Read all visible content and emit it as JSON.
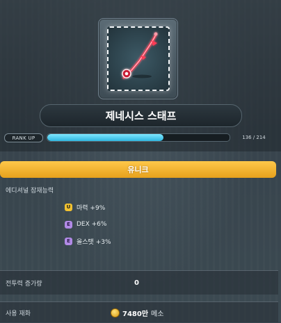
{
  "item": {
    "name": "제네시스 스태프",
    "icon": "genesis-staff-icon"
  },
  "rank": {
    "label": "RANK UP",
    "current": 136,
    "max": 214,
    "text": "136 / 214",
    "fill_fraction": 0.636
  },
  "grade": {
    "label": "유니크",
    "color": "#f0b12c"
  },
  "potential": {
    "title": "에디셔널 잠재능력",
    "options": [
      {
        "tier": "U",
        "text": "마력 +9%",
        "color": "#f2c230"
      },
      {
        "tier": "E",
        "text": "DEX +6%",
        "color": "#b18ae6"
      },
      {
        "tier": "E",
        "text": "올스탯 +3%",
        "color": "#b18ae6"
      }
    ]
  },
  "stats": {
    "combat_label": "전투력 증가량",
    "combat_value": "0",
    "cost_label": "사용 재화",
    "cost_amount": "7480만",
    "cost_unit": "메소",
    "cost_icon": "meso-coin-icon"
  }
}
